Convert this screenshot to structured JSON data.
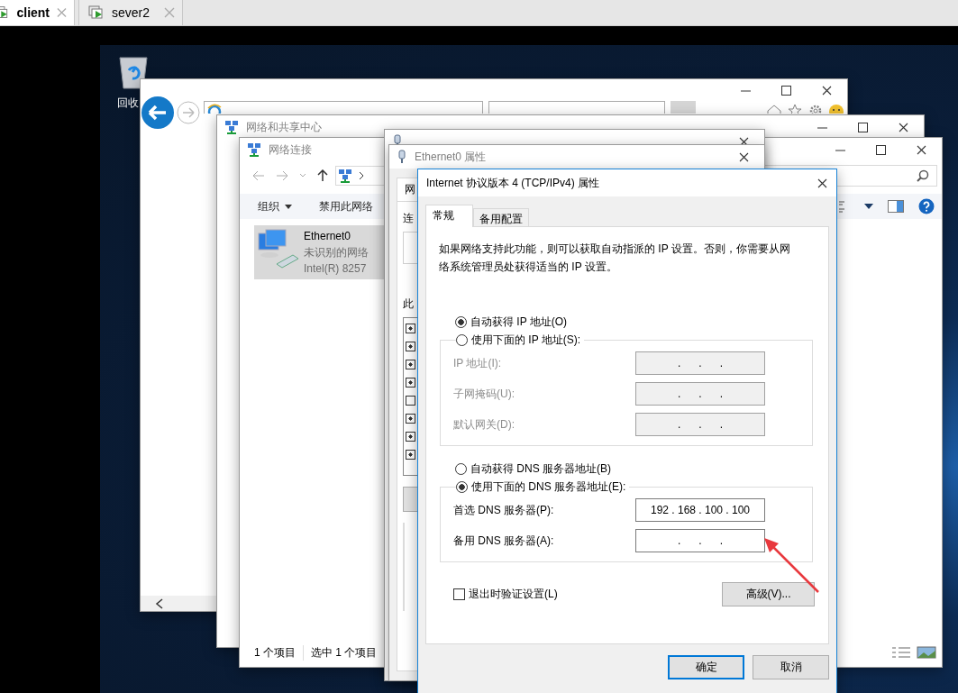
{
  "vm_tabs": [
    {
      "label": "client",
      "selected": true
    },
    {
      "label": "sever2",
      "selected": false
    }
  ],
  "desktop_icons": [
    {
      "label": "回收"
    }
  ],
  "sharing_center_window": {
    "title": "网络和共享中心"
  },
  "connections_window": {
    "title": "网络连接",
    "toolbar": [
      {
        "label": "组织",
        "kind": "menu"
      },
      {
        "label": "禁用此网络",
        "kind": "plain"
      }
    ],
    "items": [
      {
        "name": "Ethernet0",
        "status": "未识别的网络",
        "device": "Intel(R) 8257",
        "selected": true
      }
    ],
    "status_bar": [
      "1 个项目",
      "选中 1 个项目"
    ]
  },
  "properties_window": {
    "title": "Ethernet0 属性",
    "tab": "网",
    "label_1": "连",
    "label_2": "此",
    "components": [
      {
        "checked": true
      },
      {
        "checked": true
      },
      {
        "checked": true
      },
      {
        "checked": true
      },
      {
        "checked": false
      },
      {
        "checked": true
      },
      {
        "checked": true
      },
      {
        "checked": true
      }
    ]
  },
  "ipv4_dialog": {
    "title": "Internet 协议版本 4 (TCP/IPv4) 属性",
    "tabs": [
      {
        "label": "常规",
        "selected": true
      },
      {
        "label": "备用配置",
        "selected": false
      }
    ],
    "description": "如果网络支持此功能，则可以获取自动指派的 IP 设置。否则，你需要从网络系统管理员处获得适当的 IP 设置。",
    "ip_options": [
      {
        "label": "自动获得 IP 地址(O)",
        "selected": true
      },
      {
        "label": "使用下面的 IP 地址(S):",
        "selected": false
      }
    ],
    "ip_fields": [
      {
        "label": "IP 地址(I):",
        "value": ".      .      .",
        "disabled": true
      },
      {
        "label": "子网掩码(U):",
        "value": ".      .      .",
        "disabled": true
      },
      {
        "label": "默认网关(D):",
        "value": ".      .      .",
        "disabled": true
      }
    ],
    "dns_options": [
      {
        "label": "自动获得 DNS 服务器地址(B)",
        "selected": false
      },
      {
        "label": "使用下面的 DNS 服务器地址(E):",
        "selected": true
      }
    ],
    "dns_fields": [
      {
        "label": "首选 DNS 服务器(P):",
        "value": "192 . 168 . 100 . 100",
        "disabled": false
      },
      {
        "label": "备用 DNS 服务器(A):",
        "value": ".      .      .",
        "disabled": false
      }
    ],
    "validate_on_exit": {
      "label": "退出时验证设置(L)",
      "checked": false
    },
    "advanced_button": "高级(V)...",
    "buttons": [
      {
        "label": "确定",
        "kind": "default"
      },
      {
        "label": "取消",
        "kind": "normal"
      }
    ]
  }
}
